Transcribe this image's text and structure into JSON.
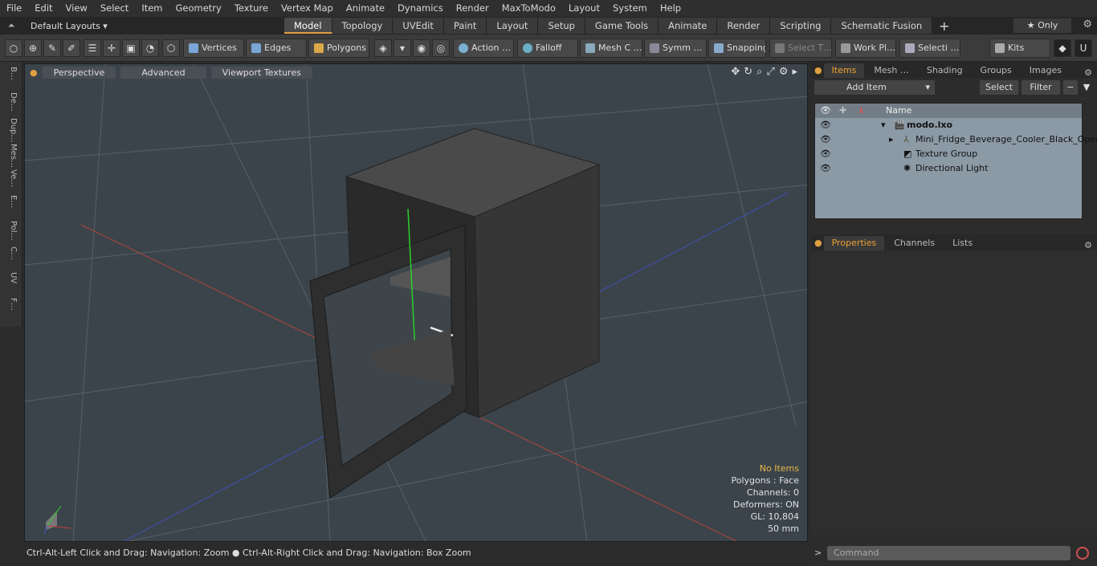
{
  "menu": [
    "File",
    "Edit",
    "View",
    "Select",
    "Item",
    "Geometry",
    "Texture",
    "Vertex Map",
    "Animate",
    "Dynamics",
    "Render",
    "MaxToModo",
    "Layout",
    "System",
    "Help"
  ],
  "layouts": {
    "default": "Default Layouts ▾",
    "tabs": [
      "Model",
      "Topology",
      "UVEdit",
      "Paint",
      "Layout",
      "Setup",
      "Game Tools",
      "Animate",
      "Render",
      "Scripting",
      "Schematic Fusion"
    ],
    "active": "Model",
    "only": "★ Only"
  },
  "toolbar": {
    "vertices": "Vertices",
    "edges": "Edges",
    "polygons": "Polygons",
    "action": "Action …",
    "falloff": "Falloff",
    "meshc": "Mesh C …",
    "symm": "Symm …",
    "snapping": "Snapping",
    "selectt": "Select T…",
    "workpl": "Work Pl…",
    "selecti": "Selecti …",
    "kits": "Kits"
  },
  "lefttabs": [
    "B…",
    "De…",
    "Dup…",
    "Mes…",
    "Ve…",
    "E…",
    "Pol…",
    "C…",
    "UV",
    "F…"
  ],
  "viewport": {
    "perspective": "Perspective",
    "advanced": "Advanced",
    "textures": "Viewport Textures"
  },
  "info": {
    "noitems": "No Items",
    "polygons": "Polygons : Face",
    "channels": "Channels: 0",
    "deformers": "Deformers: ON",
    "gl": "GL: 10,804",
    "size": "50 mm"
  },
  "status": "Ctrl-Alt-Left Click and Drag: Navigation: Zoom ● Ctrl-Alt-Right Click and Drag: Navigation: Box Zoom",
  "panel": {
    "tabs": [
      "Items",
      "Mesh …",
      "Shading",
      "Groups",
      "Images"
    ],
    "additem": "Add Item",
    "select": "Select",
    "filter": "Filter",
    "namecol": "Name",
    "items": [
      "modo.lxo",
      "Mini_Fridge_Beverage_Cooler_Black_Open",
      "Texture Group",
      "Directional Light"
    ],
    "ptabs": [
      "Properties",
      "Channels",
      "Lists"
    ]
  },
  "command": "Command"
}
